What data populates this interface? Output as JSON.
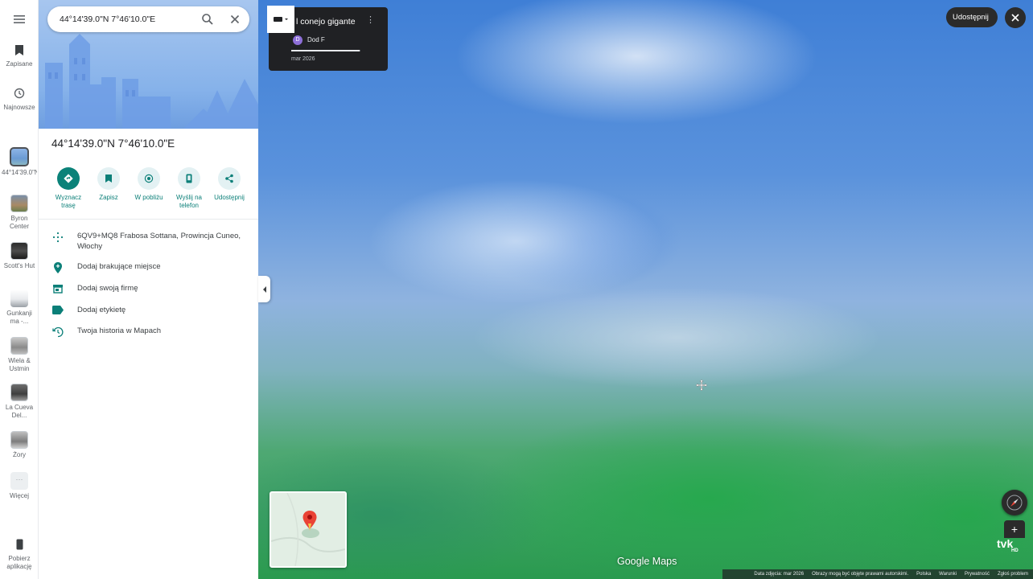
{
  "rail": {
    "saved_label": "Zapisane",
    "recent_label": "Najnowsze",
    "history": [
      {
        "label": "44°14'39.0\"N..."
      },
      {
        "label": "Byron Center"
      },
      {
        "label": "Scott's Hut"
      },
      {
        "label": "Gunkanji ma -..."
      },
      {
        "label": "Wiela & Ustmin"
      },
      {
        "label": "La Cueva Del..."
      },
      {
        "label": "Żory"
      }
    ],
    "more_label": "Więcej",
    "get_app_label": "Pobierz aplikację"
  },
  "search": {
    "value": "44°14'39.0\"N 7°46'10.0\"E"
  },
  "place": {
    "title": "44°14'39.0\"N 7°46'10.0\"E"
  },
  "actions": [
    {
      "label": "Wyznacz trasę"
    },
    {
      "label": "Zapisz"
    },
    {
      "label": "W pobliżu"
    },
    {
      "label": "Wyślij na telefon"
    },
    {
      "label": "Udostępnij"
    }
  ],
  "info": {
    "plus_code": "6QV9+MQ8 Frabosa Sottana, Prowincja Cuneo, Włochy",
    "add_missing": "Dodaj brakujące miejsce",
    "add_business": "Dodaj swoją firmę",
    "add_label": "Dodaj etykietę",
    "history": "Twoja historia w Mapach"
  },
  "streetview": {
    "card_title": "l conejo gigante",
    "author_initial": "D",
    "author": "Dod F",
    "date": "mar 2026",
    "progress": 0.99,
    "logo": "Google Maps",
    "share_label": "Udostępnij",
    "badge_main": "tvk",
    "badge_sub": "HD"
  },
  "footer": {
    "image_date": "Data zdjęcia: mar 2026",
    "notice": "Obrazy mogą być objęte prawami autorskimi.",
    "language": "Polska",
    "terms": "Warunki",
    "privacy": "Prywatność",
    "report": "Zgłoś problem"
  },
  "colors": {
    "accent": "#0b8279",
    "dark_control": "#2b2b2b",
    "pin_red": "#ea4335"
  }
}
